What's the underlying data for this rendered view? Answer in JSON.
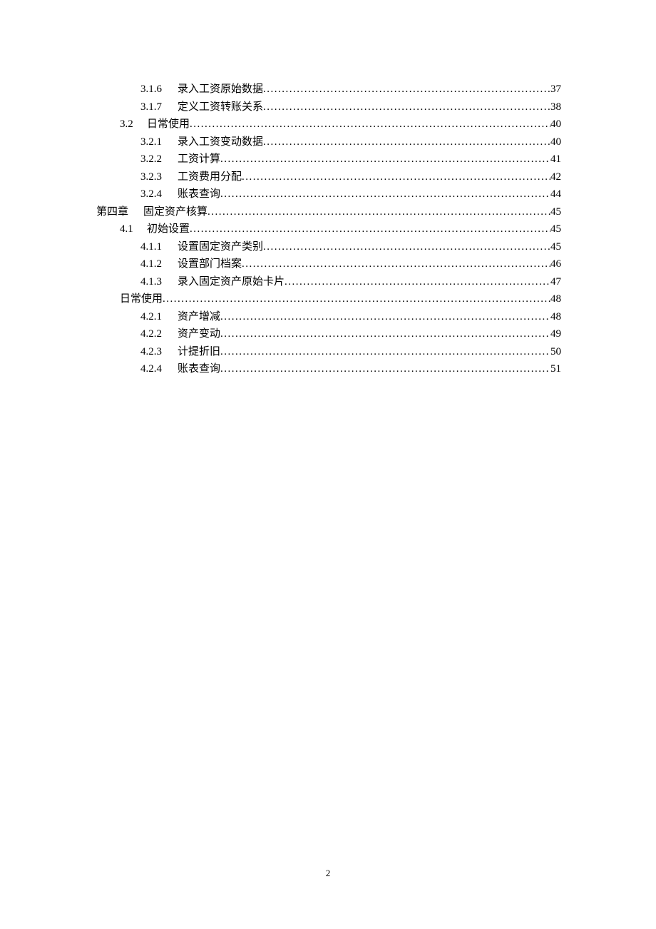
{
  "toc": [
    {
      "level": "l3",
      "num": "3.1.6",
      "title": "录入工资原始数据",
      "page": "37"
    },
    {
      "level": "l3",
      "num": "3.1.7",
      "title": "定义工资转账关系",
      "page": "38"
    },
    {
      "level": "l2",
      "num": "3.2",
      "title": "日常使用",
      "page": "40"
    },
    {
      "level": "l3",
      "num": "3.2.1",
      "title": "录入工资变动数据",
      "page": "40"
    },
    {
      "level": "l3",
      "num": "3.2.2",
      "title": "工资计算",
      "page": "41"
    },
    {
      "level": "l3",
      "num": "3.2.3",
      "title": "工资费用分配",
      "page": "42"
    },
    {
      "level": "l3",
      "num": "3.2.4",
      "title": "账表查询",
      "page": "44"
    },
    {
      "level": "l1",
      "num": "第四章",
      "title": "固定资产核算",
      "page": "45"
    },
    {
      "level": "l2",
      "num": "4.1",
      "title": "初始设置",
      "page": "45"
    },
    {
      "level": "l3",
      "num": "4.1.1",
      "title": "设置固定资产类别",
      "page": "45"
    },
    {
      "level": "l3",
      "num": "4.1.2",
      "title": "设置部门档案",
      "page": "46"
    },
    {
      "level": "l3",
      "num": "4.1.3",
      "title": "录入固定资产原始卡片",
      "page": "47"
    },
    {
      "level": "l2b",
      "num": "",
      "title": "日常使用",
      "page": "48"
    },
    {
      "level": "l3",
      "num": "4.2.1",
      "title": "资产增减",
      "page": "48"
    },
    {
      "level": "l3",
      "num": "4.2.2",
      "title": "资产变动",
      "page": "49"
    },
    {
      "level": "l3",
      "num": "4.2.3",
      "title": "计提折旧",
      "page": "50"
    },
    {
      "level": "l3",
      "num": "4.2.4",
      "title": "账表查询",
      "page": "51"
    }
  ],
  "page_number": "2"
}
